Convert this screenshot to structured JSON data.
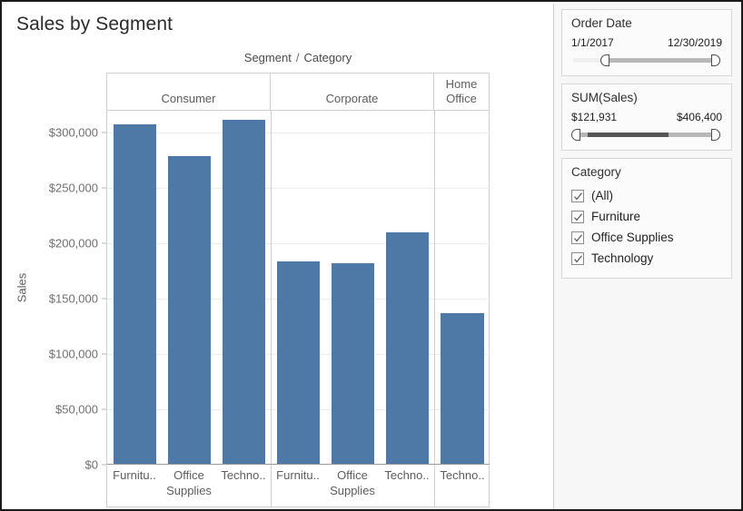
{
  "window": {
    "accent_color": "#4e79a7"
  },
  "worksheet": {
    "title": "Sales by Segment",
    "column_field_header": {
      "first": "Segment",
      "separator": "/",
      "second": "Category"
    },
    "y_axis_title": "Sales"
  },
  "chart_data": {
    "type": "bar",
    "title": "Sales by Segment",
    "xlabel": "Segment / Category",
    "ylabel": "Sales",
    "ylim": [
      0,
      320000
    ],
    "yticks": [
      0,
      50000,
      100000,
      150000,
      200000,
      250000,
      300000
    ],
    "ytick_labels": [
      "$0",
      "$50,000",
      "$100,000",
      "$150,000",
      "$200,000",
      "$250,000",
      "$300,000"
    ],
    "grid": true,
    "legend": "none",
    "groups": [
      {
        "name": "Consumer",
        "categories": [
          "Furnitu..",
          "Office\nSupplies",
          "Techno.."
        ],
        "category_full": [
          "Furniture",
          "Office Supplies",
          "Technology"
        ],
        "values": [
          306500,
          278500,
          310800
        ]
      },
      {
        "name": "Corporate",
        "categories": [
          "Furnitu..",
          "Office\nSupplies",
          "Techno.."
        ],
        "category_full": [
          "Furniture",
          "Office Supplies",
          "Technology"
        ],
        "values": [
          183000,
          181400,
          209400
        ]
      },
      {
        "name": "Home\nOffice",
        "categories": [
          "Techno.."
        ],
        "category_full": [
          "Technology"
        ],
        "values": [
          136000
        ]
      }
    ]
  },
  "filters": {
    "order_date": {
      "title": "Order Date",
      "min_label": "1/1/2017",
      "max_label": "12/30/2019",
      "handle_left_pct": 24,
      "handle_right_pct": 100,
      "fill_start_pct": 24,
      "fill_end_pct": 100
    },
    "sum_sales": {
      "title": "SUM(Sales)",
      "min_label": "$121,931",
      "max_label": "$406,400",
      "handle_left_pct": 4,
      "handle_right_pct": 100,
      "fill_start_pct": 10,
      "fill_end_pct": 65
    },
    "category": {
      "title": "Category",
      "items": [
        {
          "label": "(All)",
          "checked": true
        },
        {
          "label": "Furniture",
          "checked": true
        },
        {
          "label": "Office Supplies",
          "checked": true
        },
        {
          "label": "Technology",
          "checked": true
        }
      ]
    }
  }
}
